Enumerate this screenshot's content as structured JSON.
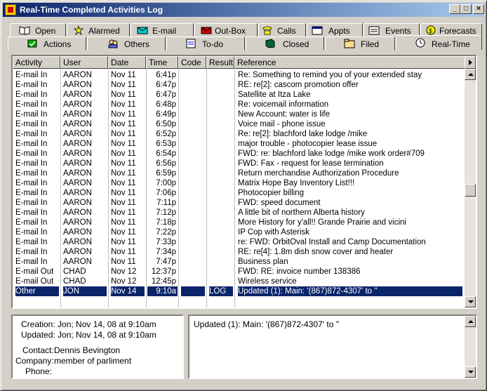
{
  "window": {
    "title": "Real-Time Completed Activities Log"
  },
  "titlebar_buttons": {
    "minimize": "_",
    "maximize": "□",
    "close": "×"
  },
  "tabs_row1": [
    {
      "label": "Open",
      "icon": "book-icon"
    },
    {
      "label": "Alarmed",
      "icon": "alarm-icon"
    },
    {
      "label": "E-mail",
      "icon": "email-icon"
    },
    {
      "label": "Out-Box",
      "icon": "outbox-icon"
    },
    {
      "label": "Calls",
      "icon": "calls-icon"
    },
    {
      "label": "Appts",
      "icon": "appts-icon"
    },
    {
      "label": "Events",
      "icon": "events-icon"
    },
    {
      "label": "Forecasts",
      "icon": "forecasts-icon"
    }
  ],
  "tabs_row2": [
    {
      "label": "Actions",
      "icon": "actions-icon"
    },
    {
      "label": "Others",
      "icon": "others-icon"
    },
    {
      "label": "To-do",
      "icon": "todo-icon"
    },
    {
      "label": "Closed",
      "icon": "closed-icon"
    },
    {
      "label": "Filed",
      "icon": "filed-icon"
    },
    {
      "label": "Real-Time",
      "icon": "clock-icon"
    }
  ],
  "list": {
    "columns": [
      "Activity",
      "User",
      "Date",
      "Time",
      "Code",
      "Result",
      "Reference"
    ],
    "rows": [
      [
        "E-mail In",
        "AARON",
        "Nov 11",
        "6:41p",
        "",
        "",
        "Re: Something to remind you of your extended stay"
      ],
      [
        "E-mail In",
        "AARON",
        "Nov 11",
        "6:47p",
        "",
        "",
        "RE: re[2]: cascom promotion offer"
      ],
      [
        "E-mail In",
        "AARON",
        "Nov 11",
        "6:47p",
        "",
        "",
        "Satellite at Itza Lake"
      ],
      [
        "E-mail In",
        "AARON",
        "Nov 11",
        "6:48p",
        "",
        "",
        "Re: voicemail information"
      ],
      [
        "E-mail In",
        "AARON",
        "Nov 11",
        "6:49p",
        "",
        "",
        "New Account: water is life"
      ],
      [
        "E-mail In",
        "AARON",
        "Nov 11",
        "6:50p",
        "",
        "",
        "Voice mail - phone issue"
      ],
      [
        "E-mail In",
        "AARON",
        "Nov 11",
        "6:52p",
        "",
        "",
        "Re: re[2]: blachford lake lodge /mike"
      ],
      [
        "E-mail In",
        "AARON",
        "Nov 11",
        "6:53p",
        "",
        "",
        "major trouble - photocopier lease issue"
      ],
      [
        "E-mail In",
        "AARON",
        "Nov 11",
        "6:54p",
        "",
        "",
        "FWD: re: blachford lake lodge /mike work order#709"
      ],
      [
        "E-mail In",
        "AARON",
        "Nov 11",
        "6:56p",
        "",
        "",
        "FWD: Fax - request for lease termination"
      ],
      [
        "E-mail In",
        "AARON",
        "Nov 11",
        "6:59p",
        "",
        "",
        "Return merchandise Authorization Procedure"
      ],
      [
        "E-mail In",
        "AARON",
        "Nov 11",
        "7:00p",
        "",
        "",
        "Matrix Hope Bay Inventory List!!!"
      ],
      [
        "E-mail In",
        "AARON",
        "Nov 11",
        "7:06p",
        "",
        "",
        "Photocopier billing"
      ],
      [
        "E-mail In",
        "AARON",
        "Nov 11",
        "7:11p",
        "",
        "",
        "FWD: speed document"
      ],
      [
        "E-mail In",
        "AARON",
        "Nov 11",
        "7:12p",
        "",
        "",
        "A little bit of northern Alberta history"
      ],
      [
        "E-mail In",
        "AARON",
        "Nov 11",
        "7:18p",
        "",
        "",
        "More History for y'all!! Grande Prairie and vicini"
      ],
      [
        "E-mail In",
        "AARON",
        "Nov 11",
        "7:22p",
        "",
        "",
        "IP Cop with Asterisk"
      ],
      [
        "E-mail In",
        "AARON",
        "Nov 11",
        "7:33p",
        "",
        "",
        "re: FWD: OrbitOval Install and Camp Documentation"
      ],
      [
        "E-mail In",
        "AARON",
        "Nov 11",
        "7:34p",
        "",
        "",
        "RE: re[4]: 1.8m dish snow cover and heater"
      ],
      [
        "E-mail In",
        "AARON",
        "Nov 11",
        "7:47p",
        "",
        "",
        "Business plan"
      ],
      [
        "E-mail Out",
        "CHAD",
        "Nov 12",
        "12:37p",
        "",
        "",
        "FWD: RE: invoice number 138386"
      ],
      [
        "E-mail Out",
        "CHAD",
        "Nov 12",
        "12:45p",
        "",
        "",
        "Wireless service"
      ],
      [
        "Other",
        "JON",
        "Nov 14",
        "9:10a",
        "",
        "LOG",
        "Updated (1):  Main: '(867)872-4307' to ''"
      ]
    ],
    "selected_index": 22
  },
  "details": {
    "creation": "Creation: Jon; Nov 14, 08 at 9:10am",
    "updated": "Updated: Jon; Nov 14, 08 at 9:10am",
    "contact_label": "Contact:",
    "contact_value": "Dennis Bevington",
    "company_label": "Company:",
    "company_value": "member of parliment",
    "phone_label": "Phone:",
    "phone_value": ""
  },
  "reference_view": {
    "text": "Updated (1):  Main: '(867)872-4307' to ''"
  },
  "colors": {
    "title_start": "#0a246a",
    "title_end": "#a6caf0",
    "selection": "#0a246a",
    "face": "#d4d0c8"
  }
}
